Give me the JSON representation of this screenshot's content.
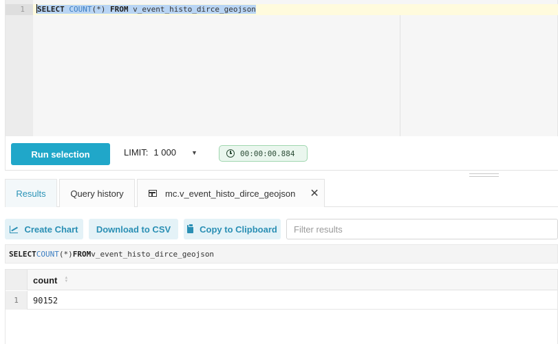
{
  "editor": {
    "line_number": "1",
    "sql": {
      "kw_select": "SELECT",
      "fn_count": "COUNT",
      "paren": "(*)",
      "kw_from": "FROM",
      "table": "v_event_histo_dirce_geojson"
    }
  },
  "toolbar": {
    "run_label": "Run selection",
    "limit_label": "LIMIT:",
    "limit_value": "1 000",
    "timer": "00:00:00.884"
  },
  "tabs": [
    {
      "label": "Results"
    },
    {
      "label": "Query history"
    },
    {
      "label": "mc.v_event_histo_dirce_geojson"
    }
  ],
  "actions": {
    "create_chart": "Create Chart",
    "download_csv": "Download to CSV",
    "copy_clipboard": "Copy to Clipboard",
    "filter_placeholder": "Filter results"
  },
  "query": {
    "kw_select": "SELECT",
    "fn_count": "COUNT",
    "paren": "(*)",
    "kw_from": "FROM",
    "table": "v_event_histo_dirce_geojson"
  },
  "results": {
    "columns": [
      "count"
    ],
    "rows": [
      {
        "row_number": "1",
        "values": [
          "90152"
        ]
      }
    ]
  },
  "colors": {
    "accent": "#20a7c9",
    "timer_bg": "#eaf6ee"
  }
}
